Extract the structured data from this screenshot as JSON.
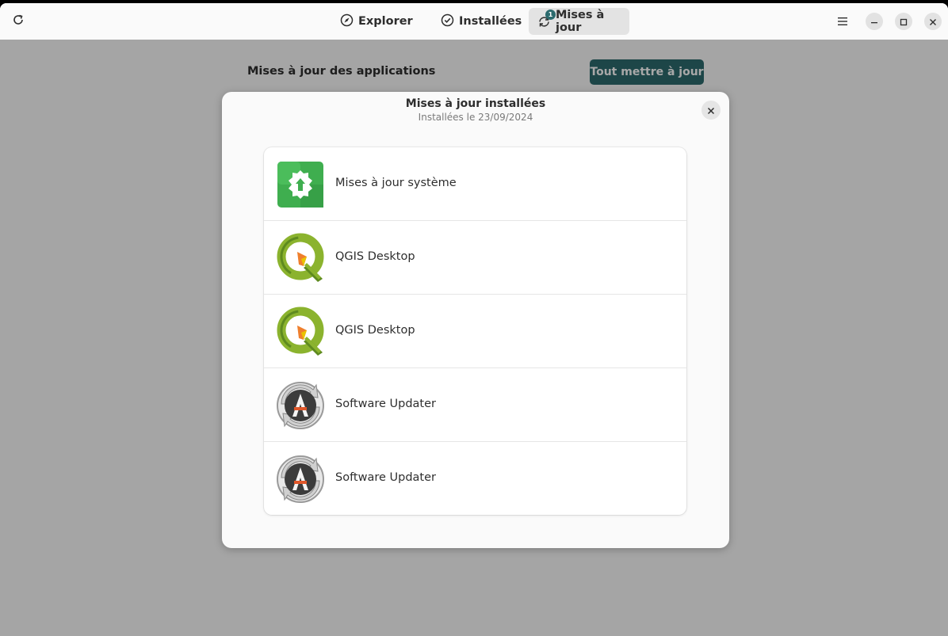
{
  "header": {
    "tabs": [
      {
        "label": "Explorer",
        "icon": "compass-icon"
      },
      {
        "label": "Installées",
        "icon": "check-circle-icon"
      },
      {
        "label": "Mises à jour",
        "icon": "refresh-icon",
        "badge": "1"
      }
    ],
    "active_tab": "Mises à jour"
  },
  "page": {
    "title": "Mises à jour des applications",
    "update_all_label": "Tout mettre à jour"
  },
  "dialog": {
    "title": "Mises à jour installées",
    "subtitle": "Installées le 23/09/2024",
    "items": [
      {
        "label": "Mises à jour système",
        "icon": "system-update-icon"
      },
      {
        "label": "QGIS Desktop",
        "icon": "qgis-icon"
      },
      {
        "label": "QGIS Desktop",
        "icon": "qgis-icon"
      },
      {
        "label": "Software Updater",
        "icon": "software-updater-icon"
      },
      {
        "label": "Software Updater",
        "icon": "software-updater-icon"
      }
    ]
  },
  "colors": {
    "accent": "#2c6b6e",
    "window_bg": "#fafafa"
  }
}
